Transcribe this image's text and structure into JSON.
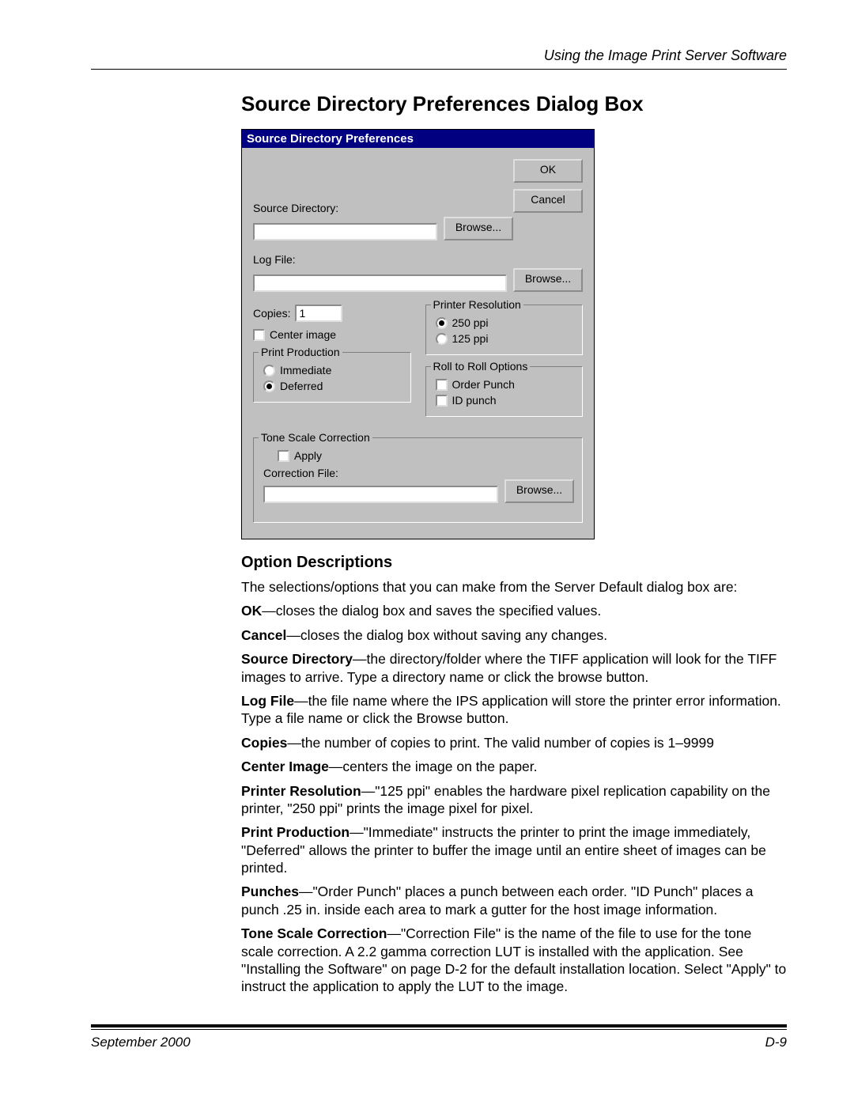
{
  "header": "Using the Image Print Server Software",
  "section_title": "Source Directory Preferences Dialog Box",
  "dialog": {
    "title": "Source Directory Preferences",
    "btn_ok": "OK",
    "btn_cancel": "Cancel",
    "btn_browse": "Browse...",
    "lbl_source_dir": "Source Directory:",
    "val_source_dir": "",
    "lbl_log_file": "Log File:",
    "val_log_file": "",
    "lbl_copies": "Copies:",
    "val_copies": "1",
    "lbl_center_image": "Center image",
    "grp_printer_res": "Printer Resolution",
    "opt_250ppi": "250 ppi",
    "opt_125ppi": "125 ppi",
    "grp_print_prod": "Print Production",
    "opt_immediate": "Immediate",
    "opt_deferred": "Deferred",
    "grp_roll": "Roll to Roll Options",
    "opt_order_punch": "Order Punch",
    "opt_id_punch": "ID punch",
    "grp_tone": "Tone Scale Correction",
    "lbl_apply": "Apply",
    "lbl_correction_file": "Correction File:",
    "val_correction_file": ""
  },
  "desc_heading": "Option Descriptions",
  "desc_intro": "The selections/options that you can make from the Server Default dialog box are:",
  "d_ok_b": "OK",
  "d_ok_t": "—closes the dialog box and saves the specified values.",
  "d_cancel_b": "Cancel",
  "d_cancel_t": "—closes the dialog box without saving any changes.",
  "d_src_b": "Source Directory",
  "d_src_t": "—the directory/folder where the TIFF application will look for the TIFF images to arrive. Type a directory name or click the browse button.",
  "d_log_b": "Log File",
  "d_log_t": "—the file name where the IPS application will store the printer error information. Type a file name or click the Browse button.",
  "d_copies_b": "Copies",
  "d_copies_t": "—the number of copies to print. The valid number of copies is 1–9999",
  "d_center_b": "Center Image",
  "d_center_t": "—centers the image on the paper.",
  "d_pres_b": "Printer Resolution",
  "d_pres_t": "—\"125 ppi\" enables the hardware pixel replication capability on the printer, \"250 ppi\" prints the image pixel for pixel.",
  "d_pprod_b": "Print Production",
  "d_pprod_t": "—\"Immediate\" instructs the printer to print the image immediately, \"Deferred\" allows the printer to buffer the image until an entire sheet of images can be printed.",
  "d_punch_b": "Punches",
  "d_punch_t": "—\"Order Punch\" places a punch between each order. \"ID Punch\" places a punch .25 in. inside each area to mark a gutter for the host image information.",
  "d_tone_b": "Tone Scale Correction",
  "d_tone_t": "—\"Correction File\" is the name of the file to use for the tone scale correction. A 2.2 gamma correction LUT is installed with the application. See \"Installing the Software\" on page D-2 for the default installation location. Select \"Apply\" to instruct the application to apply the LUT to the image.",
  "footer_left": "September 2000",
  "footer_right": "D-9"
}
